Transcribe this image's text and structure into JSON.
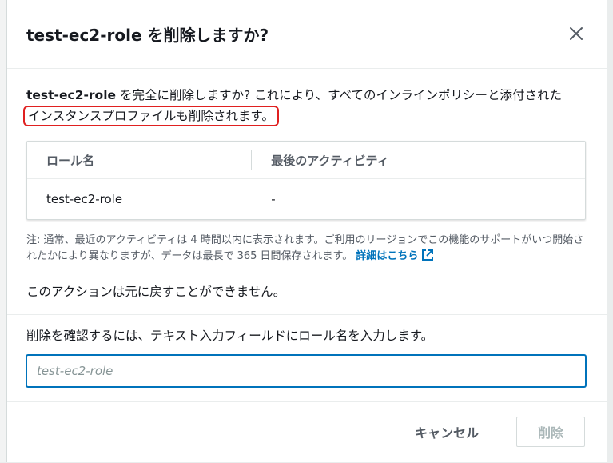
{
  "dialog": {
    "title_role": "test-ec2-role",
    "title_suffix": " を削除しますか?",
    "description": {
      "role_name": "test-ec2-role",
      "text_part1": " を完全に削除しますか? これにより、すべてのインラインポリシーと添付された",
      "highlighted_text": "インスタンスプロファイルも削除されます。"
    },
    "table": {
      "headers": [
        "ロール名",
        "最後のアクティビティ"
      ],
      "rows": [
        {
          "role_name": "test-ec2-role",
          "last_activity": "-"
        }
      ]
    },
    "note": {
      "text": "注: 通常、最近のアクティビティは 4 時間以内に表示されます。ご利用のリージョンでこの機能のサポートがいつ開始されたかにより異なりますが、データは最長で 365 日間保存されます。",
      "link_label": "詳細はこちら"
    },
    "irreversible_text": "このアクションは元に戻すことができません。",
    "confirm_label": "削除を確認するには、テキスト入力フィールドにロール名を入力します。",
    "confirm_input": {
      "placeholder": "test-ec2-role",
      "value": ""
    },
    "buttons": {
      "cancel": "キャンセル",
      "delete": "削除"
    }
  },
  "colors": {
    "link": "#0073bb",
    "highlight_border": "#e02020",
    "disabled_text": "#aab7b8"
  },
  "icons": [
    "close-icon",
    "external-link-icon"
  ]
}
